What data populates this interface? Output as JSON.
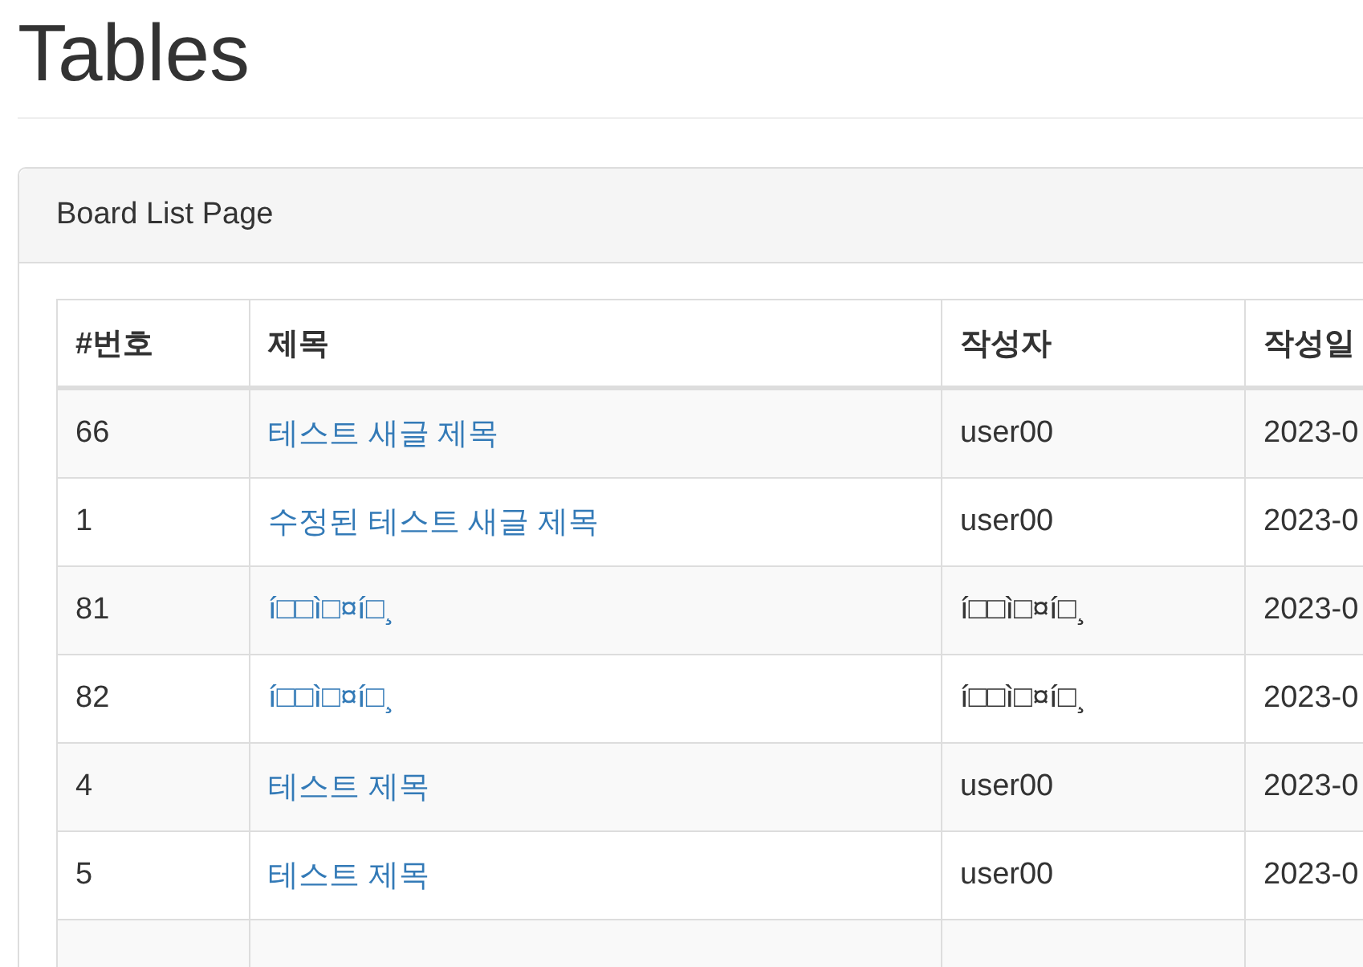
{
  "page_title": "Tables",
  "panel": {
    "heading": "Board List Page"
  },
  "table": {
    "columns": [
      "#번호",
      "제목",
      "작성자",
      "작성일"
    ],
    "rows": [
      {
        "number": "66",
        "title": "테스트 새글 제목",
        "writer": "user00",
        "date": "2023-0"
      },
      {
        "number": "1",
        "title": "수정된 테스트 새글 제목",
        "writer": "user00",
        "date": "2023-0"
      },
      {
        "number": "81",
        "title": "í□□ì□¤í□¸",
        "writer": "í□□ì□¤í□¸",
        "date": "2023-0"
      },
      {
        "number": "82",
        "title": "í□□ì□¤í□¸",
        "writer": "í□□ì□¤í□¸",
        "date": "2023-0"
      },
      {
        "number": "4",
        "title": "테스트 제목",
        "writer": "user00",
        "date": "2023-0"
      },
      {
        "number": "5",
        "title": "테스트 제목",
        "writer": "user00",
        "date": "2023-0"
      }
    ]
  }
}
